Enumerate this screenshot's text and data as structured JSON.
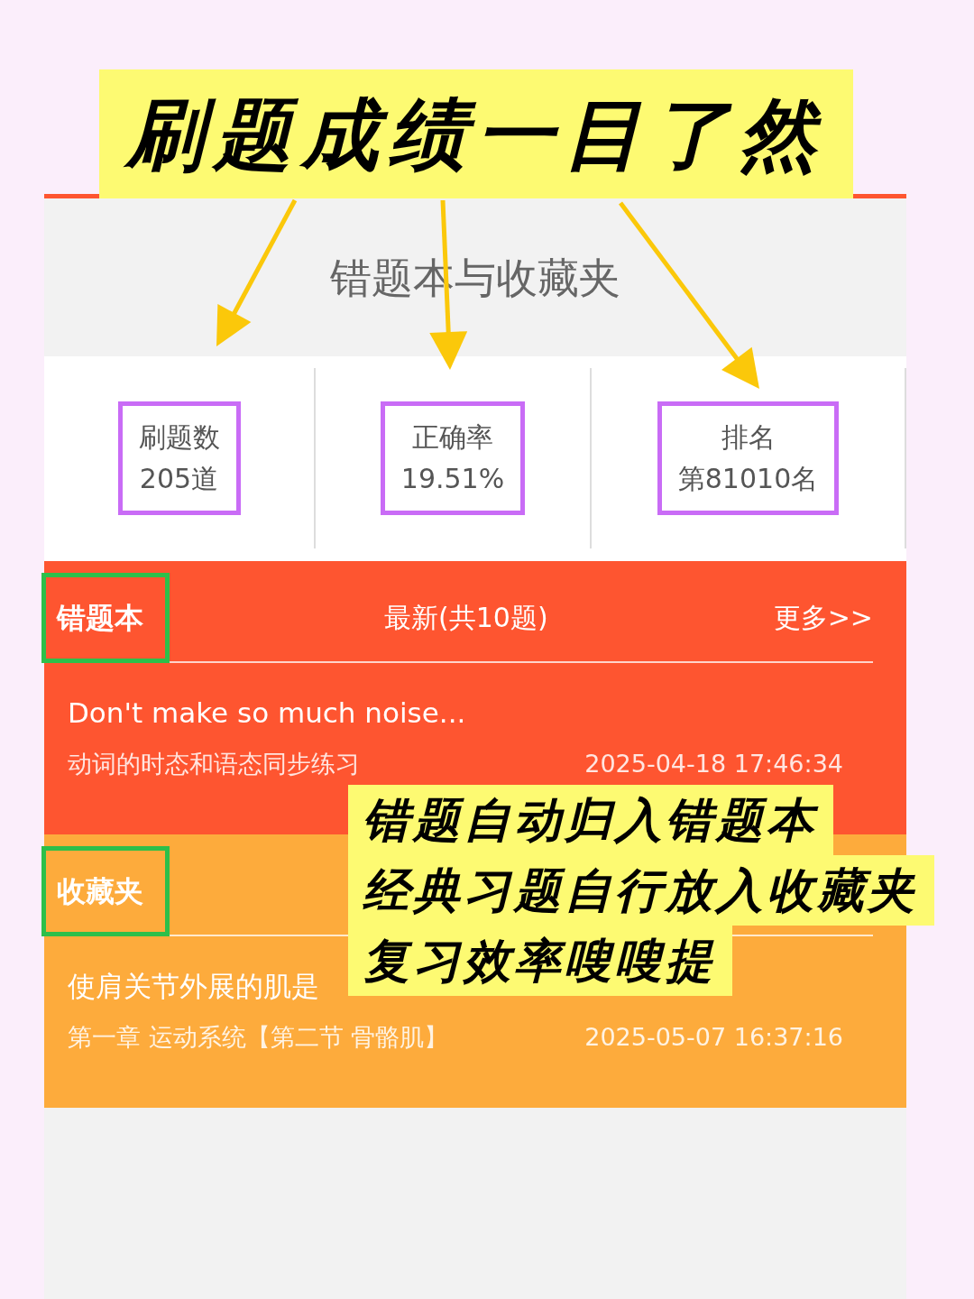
{
  "headline": "刷题成绩一目了然",
  "panel": {
    "title": "错题本与收藏夹",
    "stats": [
      {
        "label": "刷题数",
        "value": "205道"
      },
      {
        "label": "正确率",
        "value": "19.51%"
      },
      {
        "label": "排名",
        "value": "第81010名"
      }
    ],
    "sections": [
      {
        "title": "错题本",
        "color": "#fe5530",
        "subtitle": "最新(共10题)",
        "more": "更多>>",
        "items": [
          {
            "question": "Don't make so much noise...",
            "source": "动词的时态和语态同步练习",
            "time": "2025-04-18 17:46:34"
          }
        ]
      },
      {
        "title": "收藏夹",
        "color": "#fdab3c",
        "items": [
          {
            "question": "使肩关节外展的肌是",
            "source": "第一章 运动系统【第二节 骨骼肌】",
            "time": "2025-05-07 16:37:16"
          }
        ]
      }
    ]
  },
  "callout": [
    "错题自动归入错题本",
    "经典习题自行放入收藏夹",
    "复习效率嗖嗖提"
  ]
}
